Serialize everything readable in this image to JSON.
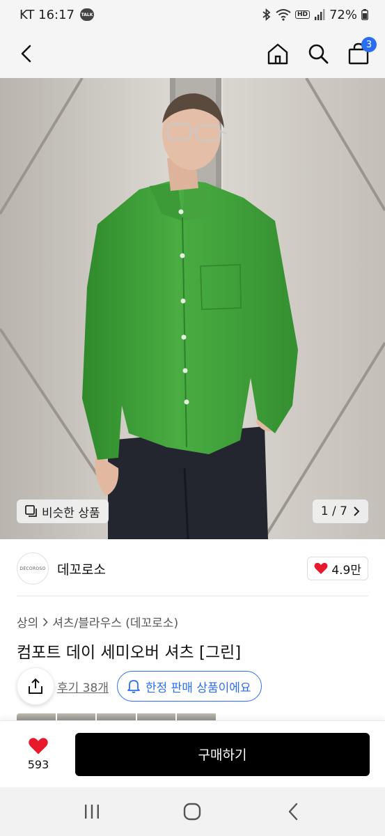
{
  "status_bar": {
    "carrier_time": "KT 16:17",
    "talk_badge": "TALK",
    "hd": "HD",
    "battery": "72%"
  },
  "top_nav": {
    "cart_count": "3",
    "icons": [
      "back-icon",
      "home-icon",
      "search-icon",
      "bag-icon"
    ]
  },
  "hero": {
    "similar_label": "비슷한 상품",
    "page_indicator": "1 / 7"
  },
  "brand": {
    "logo_text": "DECOROSO",
    "name": "데꼬로소",
    "likes": "4.9만"
  },
  "breadcrumb": {
    "category": "상의",
    "subcategory": "셔츠/블라우스 (데꼬로소)"
  },
  "product": {
    "title": "컴포트 데이 세미오버 셔츠 [그린]"
  },
  "review": {
    "reviews_label": "후기 38개",
    "limited_label": "한정 판매 상품이에요"
  },
  "bottom_bar": {
    "heart_count": "593",
    "buy_label": "구매하기"
  },
  "colors": {
    "accent_blue": "#2b6ef5",
    "heart_red": "#e8192c",
    "buy_button": "#000000",
    "shirt_green": "#3f9f3a"
  }
}
